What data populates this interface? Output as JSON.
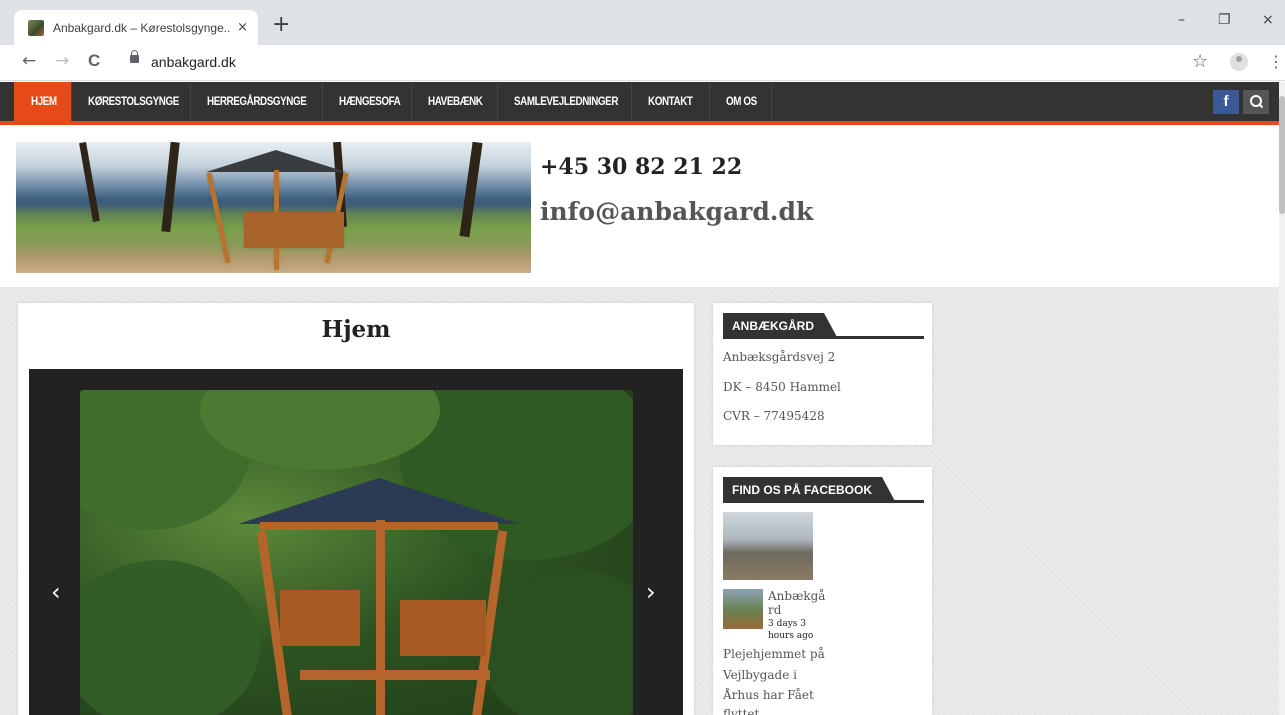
{
  "browser": {
    "tab_title": "Anbakgard.dk – Kørestolsgynge...",
    "tab_close": "×",
    "new_tab": "+",
    "url": "anbakgard.dk",
    "win_minimize": "–",
    "win_restore": "❐",
    "win_close": "×",
    "back": "←",
    "forward": "→",
    "reload": "C",
    "star": "☆",
    "menu": "⋮"
  },
  "nav": {
    "items": [
      {
        "label": "HJEM",
        "active": true
      },
      {
        "label": "KØRESTOLSGYNGE"
      },
      {
        "label": "HERREGÅRDSGYNGE"
      },
      {
        "label": "HÆNGESOFA"
      },
      {
        "label": "HAVEBÆNK"
      },
      {
        "label": "SAMLEVEJLEDNINGER"
      },
      {
        "label": "KONTAKT"
      },
      {
        "label": "OM OS"
      }
    ],
    "facebook_label": "f",
    "accent_color": "#e64a19"
  },
  "header": {
    "phone": "+45 30 82 21 22",
    "email": "info@anbakgard.dk"
  },
  "post": {
    "title": "Hjem",
    "prev_arrow": "‹",
    "next_arrow": "›"
  },
  "sidebar": {
    "address_widget": {
      "title": "ANBÆKGÅRD",
      "lines": [
        "Anbæksgårdsvej 2",
        "DK – 8450 Hammel",
        "CVR – 77495428"
      ]
    },
    "facebook_widget": {
      "title": "FIND OS PÅ FACEBOOK",
      "author_line1": "Anbækgå",
      "author_line2": "rd",
      "time_line1": "3 days 3",
      "time_line2": "hours ago",
      "text_lines": [
        "Plejehjemmet på",
        "Vejlbygade i",
        "Århus har Fået",
        "flyttet"
      ]
    }
  }
}
